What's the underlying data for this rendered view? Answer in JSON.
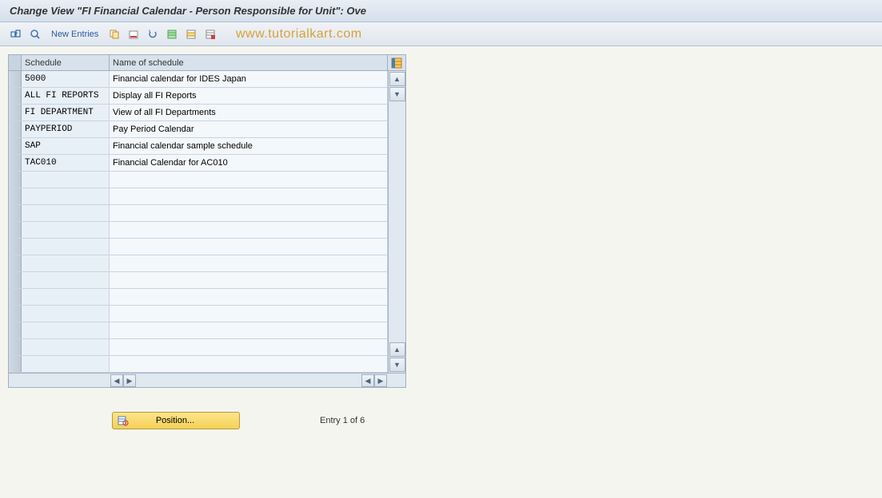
{
  "title": "Change View \"FI Financial Calendar - Person Responsible for Unit\": Ove",
  "toolbar": {
    "new_entries_label": "New Entries"
  },
  "watermark": "www.tutorialkart.com",
  "table": {
    "headers": {
      "schedule": "Schedule",
      "name": "Name of schedule"
    },
    "rows": [
      {
        "schedule": "5000",
        "name": "Financial calendar for IDES Japan"
      },
      {
        "schedule": "ALL FI REPORTS",
        "name": "Display all FI Reports"
      },
      {
        "schedule": "FI DEPARTMENT",
        "name": "View of all FI Departments"
      },
      {
        "schedule": "PAYPERIOD",
        "name": "Pay Period Calendar"
      },
      {
        "schedule": "SAP",
        "name": "Financial calendar sample schedule"
      },
      {
        "schedule": "TAC010",
        "name": "Financial Calendar for AC010"
      },
      {
        "schedule": "",
        "name": ""
      },
      {
        "schedule": "",
        "name": ""
      },
      {
        "schedule": "",
        "name": ""
      },
      {
        "schedule": "",
        "name": ""
      },
      {
        "schedule": "",
        "name": ""
      },
      {
        "schedule": "",
        "name": ""
      },
      {
        "schedule": "",
        "name": ""
      },
      {
        "schedule": "",
        "name": ""
      },
      {
        "schedule": "",
        "name": ""
      },
      {
        "schedule": "",
        "name": ""
      },
      {
        "schedule": "",
        "name": ""
      },
      {
        "schedule": "",
        "name": ""
      }
    ]
  },
  "footer": {
    "position_label": "Position...",
    "entry_text": "Entry 1 of 6"
  }
}
